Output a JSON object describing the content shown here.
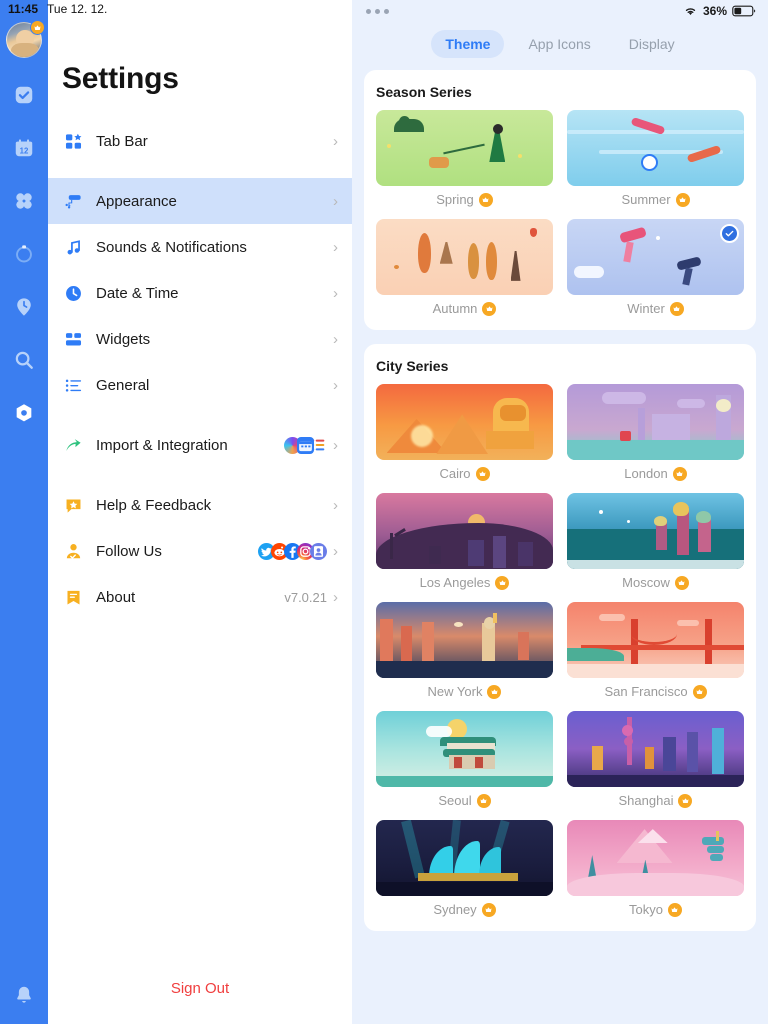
{
  "statusbar": {
    "time": "11:45",
    "date": "Tue 12. 12.",
    "battery_percent": "36%",
    "wifi_icon": "wifi-icon",
    "battery_icon": "battery-icon",
    "handle_icon": "multitask-dots-icon"
  },
  "rail": {
    "avatar_name": "user-avatar",
    "avatar_badge_icon": "crown-badge-icon",
    "items": [
      {
        "icon": "tasks-checkbox-icon",
        "name": "rail-item-tasks",
        "active": false
      },
      {
        "icon": "calendar-12-icon",
        "name": "rail-item-calendar",
        "active": false
      },
      {
        "icon": "grid-apps-icon",
        "name": "rail-item-apps",
        "active": false
      },
      {
        "icon": "timer-ring-icon",
        "name": "rail-item-timer",
        "active": false
      },
      {
        "icon": "location-clock-pin-icon",
        "name": "rail-item-places",
        "active": false
      },
      {
        "icon": "search-icon",
        "name": "rail-item-search",
        "active": false
      },
      {
        "icon": "settings-gear-icon",
        "name": "rail-item-settings",
        "active": true
      }
    ],
    "bell_icon": "bell-icon"
  },
  "settings": {
    "title": "Settings",
    "sign_out_label": "Sign Out",
    "chevron": "›",
    "groups": [
      {
        "rows": [
          {
            "label": "Tab Bar",
            "icon": "tab-bar-icon",
            "name": "settings-row-tab-bar",
            "selected": false,
            "value": ""
          }
        ]
      },
      {
        "rows": [
          {
            "label": "Appearance",
            "icon": "appearance-brush-icon",
            "name": "settings-row-appearance",
            "selected": true,
            "value": ""
          },
          {
            "label": "Sounds & Notifications",
            "icon": "music-note-icon",
            "name": "settings-row-sounds",
            "selected": false,
            "value": ""
          },
          {
            "label": "Date & Time",
            "icon": "clock-icon",
            "name": "settings-row-date-time",
            "selected": false,
            "value": ""
          },
          {
            "label": "Widgets",
            "icon": "widgets-icon",
            "name": "settings-row-widgets",
            "selected": false,
            "value": ""
          },
          {
            "label": "General",
            "icon": "general-list-icon",
            "name": "settings-row-general",
            "selected": false,
            "value": ""
          }
        ]
      },
      {
        "rows": [
          {
            "label": "Import & Integration",
            "icon": "share-arrow-icon",
            "name": "settings-row-import",
            "selected": false,
            "value": "",
            "mini_icons": [
              "siri-orb-icon",
              "calendar-blue-icon",
              "reminders-list-icon"
            ]
          }
        ]
      },
      {
        "rows": [
          {
            "label": "Help & Feedback",
            "icon": "help-star-bubble-icon",
            "name": "settings-row-help",
            "selected": false,
            "value": ""
          },
          {
            "label": "Follow Us",
            "icon": "follow-person-icon",
            "name": "settings-row-follow-us",
            "selected": false,
            "value": "",
            "mini_icons": [
              "twitter-icon",
              "reddit-icon",
              "facebook-icon",
              "instagram-icon",
              "community-icon"
            ]
          },
          {
            "label": "About",
            "icon": "about-bookmark-icon",
            "name": "settings-row-about",
            "selected": false,
            "value": "v7.0.21"
          }
        ]
      }
    ]
  },
  "theme_panel": {
    "tabs": [
      {
        "label": "Theme",
        "name": "tab-theme",
        "active": true
      },
      {
        "label": "App Icons",
        "name": "tab-app-icons",
        "active": false
      },
      {
        "label": "Display",
        "name": "tab-display",
        "active": false
      }
    ],
    "sections": [
      {
        "title": "Season Series",
        "name": "section-season-series",
        "items": [
          {
            "label": "Spring",
            "locked": true,
            "selected": false,
            "art": "spring"
          },
          {
            "label": "Summer",
            "locked": true,
            "selected": false,
            "art": "summer"
          },
          {
            "label": "Autumn",
            "locked": true,
            "selected": false,
            "art": "autumn"
          },
          {
            "label": "Winter",
            "locked": true,
            "selected": true,
            "art": "winter"
          }
        ]
      },
      {
        "title": "City Series",
        "name": "section-city-series",
        "items": [
          {
            "label": "Cairo",
            "locked": true,
            "selected": false,
            "art": "cairo"
          },
          {
            "label": "London",
            "locked": true,
            "selected": false,
            "art": "london"
          },
          {
            "label": "Los Angeles",
            "locked": true,
            "selected": false,
            "art": "losangeles"
          },
          {
            "label": "Moscow",
            "locked": true,
            "selected": false,
            "art": "moscow"
          },
          {
            "label": "New York",
            "locked": true,
            "selected": false,
            "art": "newyork"
          },
          {
            "label": "San Francisco",
            "locked": true,
            "selected": false,
            "art": "sanfrancisco"
          },
          {
            "label": "Seoul",
            "locked": true,
            "selected": false,
            "art": "seoul"
          },
          {
            "label": "Shanghai",
            "locked": true,
            "selected": false,
            "art": "shanghai"
          },
          {
            "label": "Sydney",
            "locked": true,
            "selected": false,
            "art": "sydney"
          },
          {
            "label": "Tokyo",
            "locked": true,
            "selected": false,
            "art": "tokyo"
          }
        ]
      }
    ],
    "selected_check_icon": "check-circle-icon",
    "locked_badge_icon": "crown-icon"
  },
  "colors": {
    "rail_blue": "#3b7ef0",
    "accent_blue": "#2f7cf6",
    "panel_bg": "#eaf1fd",
    "selected_row": "#cfe0fb",
    "crown_orange": "#f7a823",
    "sign_out_red": "#f03e3e"
  }
}
